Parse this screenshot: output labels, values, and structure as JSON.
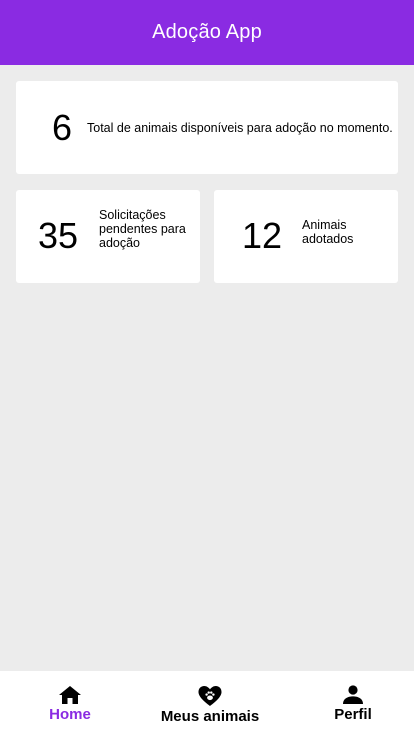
{
  "header": {
    "title": "Adoção App",
    "color": "#8a2be2"
  },
  "cards": {
    "total": {
      "value": "6",
      "description": "Total de animais disponíveis para adoção no momento."
    },
    "pending": {
      "value": "35",
      "description": "Solicitações pendentes para adoção"
    },
    "adopted": {
      "value": "12",
      "description": "Animais adotados"
    }
  },
  "bottom_nav": {
    "active_color": "#8a2be2",
    "items": [
      {
        "label": "Home",
        "icon": "home-icon",
        "active": true
      },
      {
        "label": "Meus animais",
        "icon": "heart-paw-icon",
        "active": false
      },
      {
        "label": "Perfil",
        "icon": "person-icon",
        "active": false
      }
    ]
  }
}
